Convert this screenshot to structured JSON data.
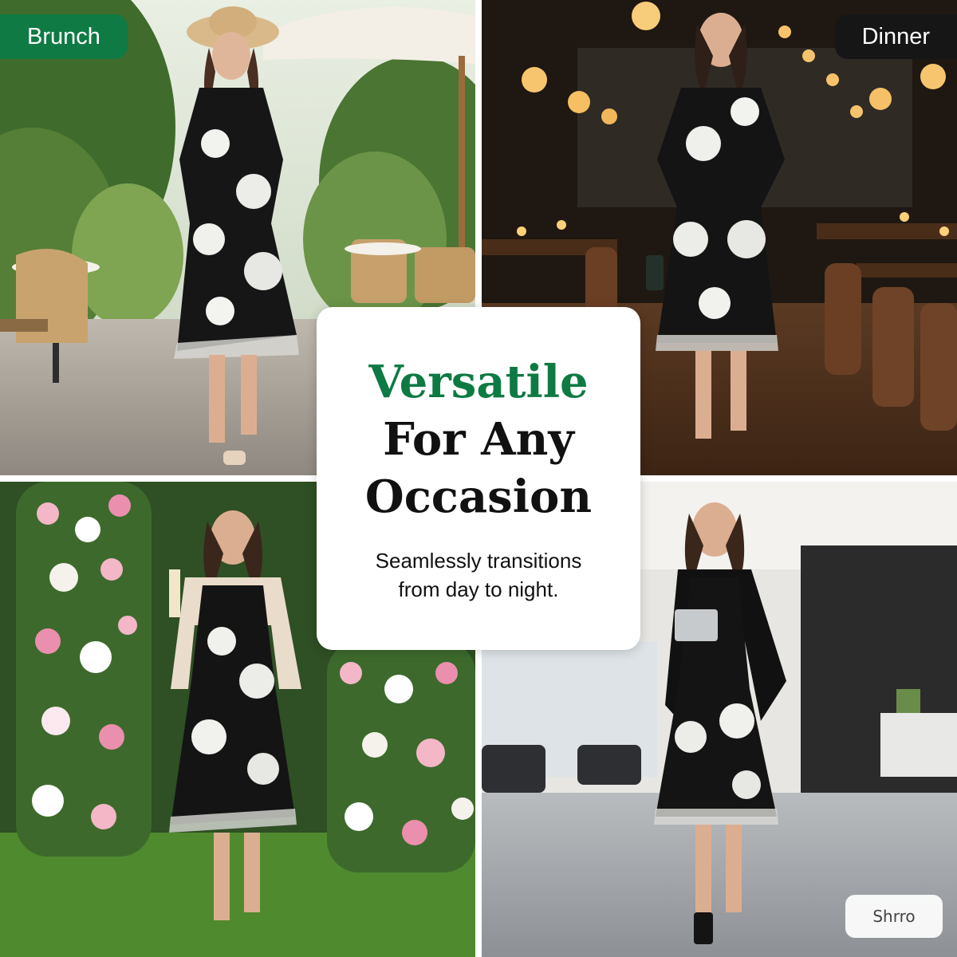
{
  "labels": {
    "brunch": "Brunch",
    "dinner": "Dinner"
  },
  "headline": {
    "line1": "Versatile",
    "line2": "For Any",
    "line3": "Occasion"
  },
  "subtitle": {
    "line1": "Seamlessly transitions",
    "line2": "from day to night."
  },
  "watermark": "Shrro",
  "colors": {
    "brunch_tag": "#0f7a44",
    "dinner_tag": "#161616",
    "headline_accent": "#0e7a43",
    "headline_dark": "#111111",
    "card_background": "#ffffff"
  }
}
